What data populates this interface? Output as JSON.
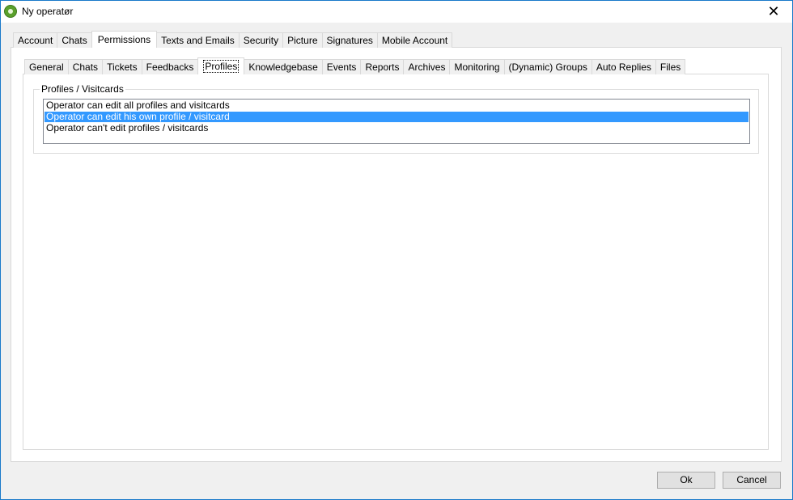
{
  "window": {
    "title": "Ny operatør"
  },
  "top_tabs": [
    {
      "label": "Account",
      "active": false
    },
    {
      "label": "Chats",
      "active": false
    },
    {
      "label": "Permissions",
      "active": true
    },
    {
      "label": "Texts and Emails",
      "active": false
    },
    {
      "label": "Security",
      "active": false
    },
    {
      "label": "Picture",
      "active": false
    },
    {
      "label": "Signatures",
      "active": false
    },
    {
      "label": "Mobile Account",
      "active": false
    }
  ],
  "sub_tabs": [
    {
      "label": "General",
      "active": false
    },
    {
      "label": "Chats",
      "active": false
    },
    {
      "label": "Tickets",
      "active": false
    },
    {
      "label": "Feedbacks",
      "active": false
    },
    {
      "label": "Profiles",
      "active": true
    },
    {
      "label": "Knowledgebase",
      "active": false
    },
    {
      "label": "Events",
      "active": false
    },
    {
      "label": "Reports",
      "active": false
    },
    {
      "label": "Archives",
      "active": false
    },
    {
      "label": "Monitoring",
      "active": false
    },
    {
      "label": "(Dynamic) Groups",
      "active": false
    },
    {
      "label": "Auto Replies",
      "active": false
    },
    {
      "label": "Files",
      "active": false
    }
  ],
  "profiles_group": {
    "title": "Profiles / Visitcards",
    "options": [
      {
        "label": "Operator can edit all profiles and visitcards",
        "selected": false
      },
      {
        "label": "Operator can edit his own profile / visitcard",
        "selected": true
      },
      {
        "label": "Operator can't edit profiles / visitcards",
        "selected": false
      }
    ]
  },
  "buttons": {
    "ok": "Ok",
    "cancel": "Cancel"
  },
  "colors": {
    "selection": "#3399ff",
    "window_border": "#1979ca"
  }
}
